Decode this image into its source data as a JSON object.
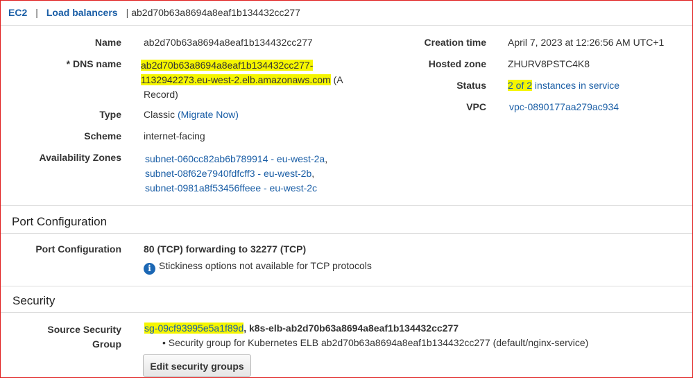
{
  "breadcrumb": {
    "ec2": "EC2",
    "sep1": "|",
    "load_balancers": "Load balancers",
    "sep2": "|",
    "current": "ab2d70b63a8694a8eaf1b134432cc277"
  },
  "details": {
    "name_label": "Name",
    "name_value": "ab2d70b63a8694a8eaf1b134432cc277",
    "dns_label": "* DNS name",
    "dns_line1": "ab2d70b63a8694a8eaf1b134432cc277-",
    "dns_line2": "1132942273.eu-west-2.elb.amazonaws.com",
    "dns_suffix1": " (A",
    "dns_suffix2": "Record)",
    "type_label": "Type",
    "type_value": "Classic",
    "migrate_link": "(Migrate Now)",
    "scheme_label": "Scheme",
    "scheme_value": "internet-facing",
    "az_label": "Availability Zones",
    "zones": [
      "subnet-060cc82ab6b789914 - eu-west-2a",
      "subnet-08f62e7940fdfcff3 - eu-west-2b",
      "subnet-0981a8f53456ffeee - eu-west-2c"
    ],
    "comma": ","
  },
  "right_details": {
    "creation_label": "Creation time",
    "creation_value": "April 7, 2023 at 12:26:56 AM UTC+1",
    "hosted_zone_label": "Hosted zone",
    "hosted_zone_value": "ZHURV8PSTC4K8",
    "status_label": "Status",
    "status_count": "2 of 2",
    "status_link": " instances in service",
    "vpc_label": "VPC",
    "vpc_value": "vpc-0890177aa279ac934"
  },
  "port_config": {
    "section_title": "Port Configuration",
    "label": "Port Configuration",
    "value": "80 (TCP) forwarding to 32277 (TCP)",
    "info_icon": "i",
    "info_text": "Stickiness options not available for TCP protocols"
  },
  "security": {
    "section_title": "Security",
    "label_line1": "Source Security",
    "label_line2": "Group",
    "sg_id": "sg-09cf93995e5a1f89d",
    "sg_name": ", k8s-elb-ab2d70b63a8694a8eaf1b134432cc277",
    "bullet": "• Security group for Kubernetes ELB ab2d70b63a8694a8eaf1b134432cc277 (default/nginx-service)",
    "edit_button": "Edit security groups"
  },
  "colors": {
    "link": "#1a5ea6",
    "highlight": "#f5f500",
    "frame_border": "#e01e1e",
    "info_icon": "#1b67b4"
  }
}
